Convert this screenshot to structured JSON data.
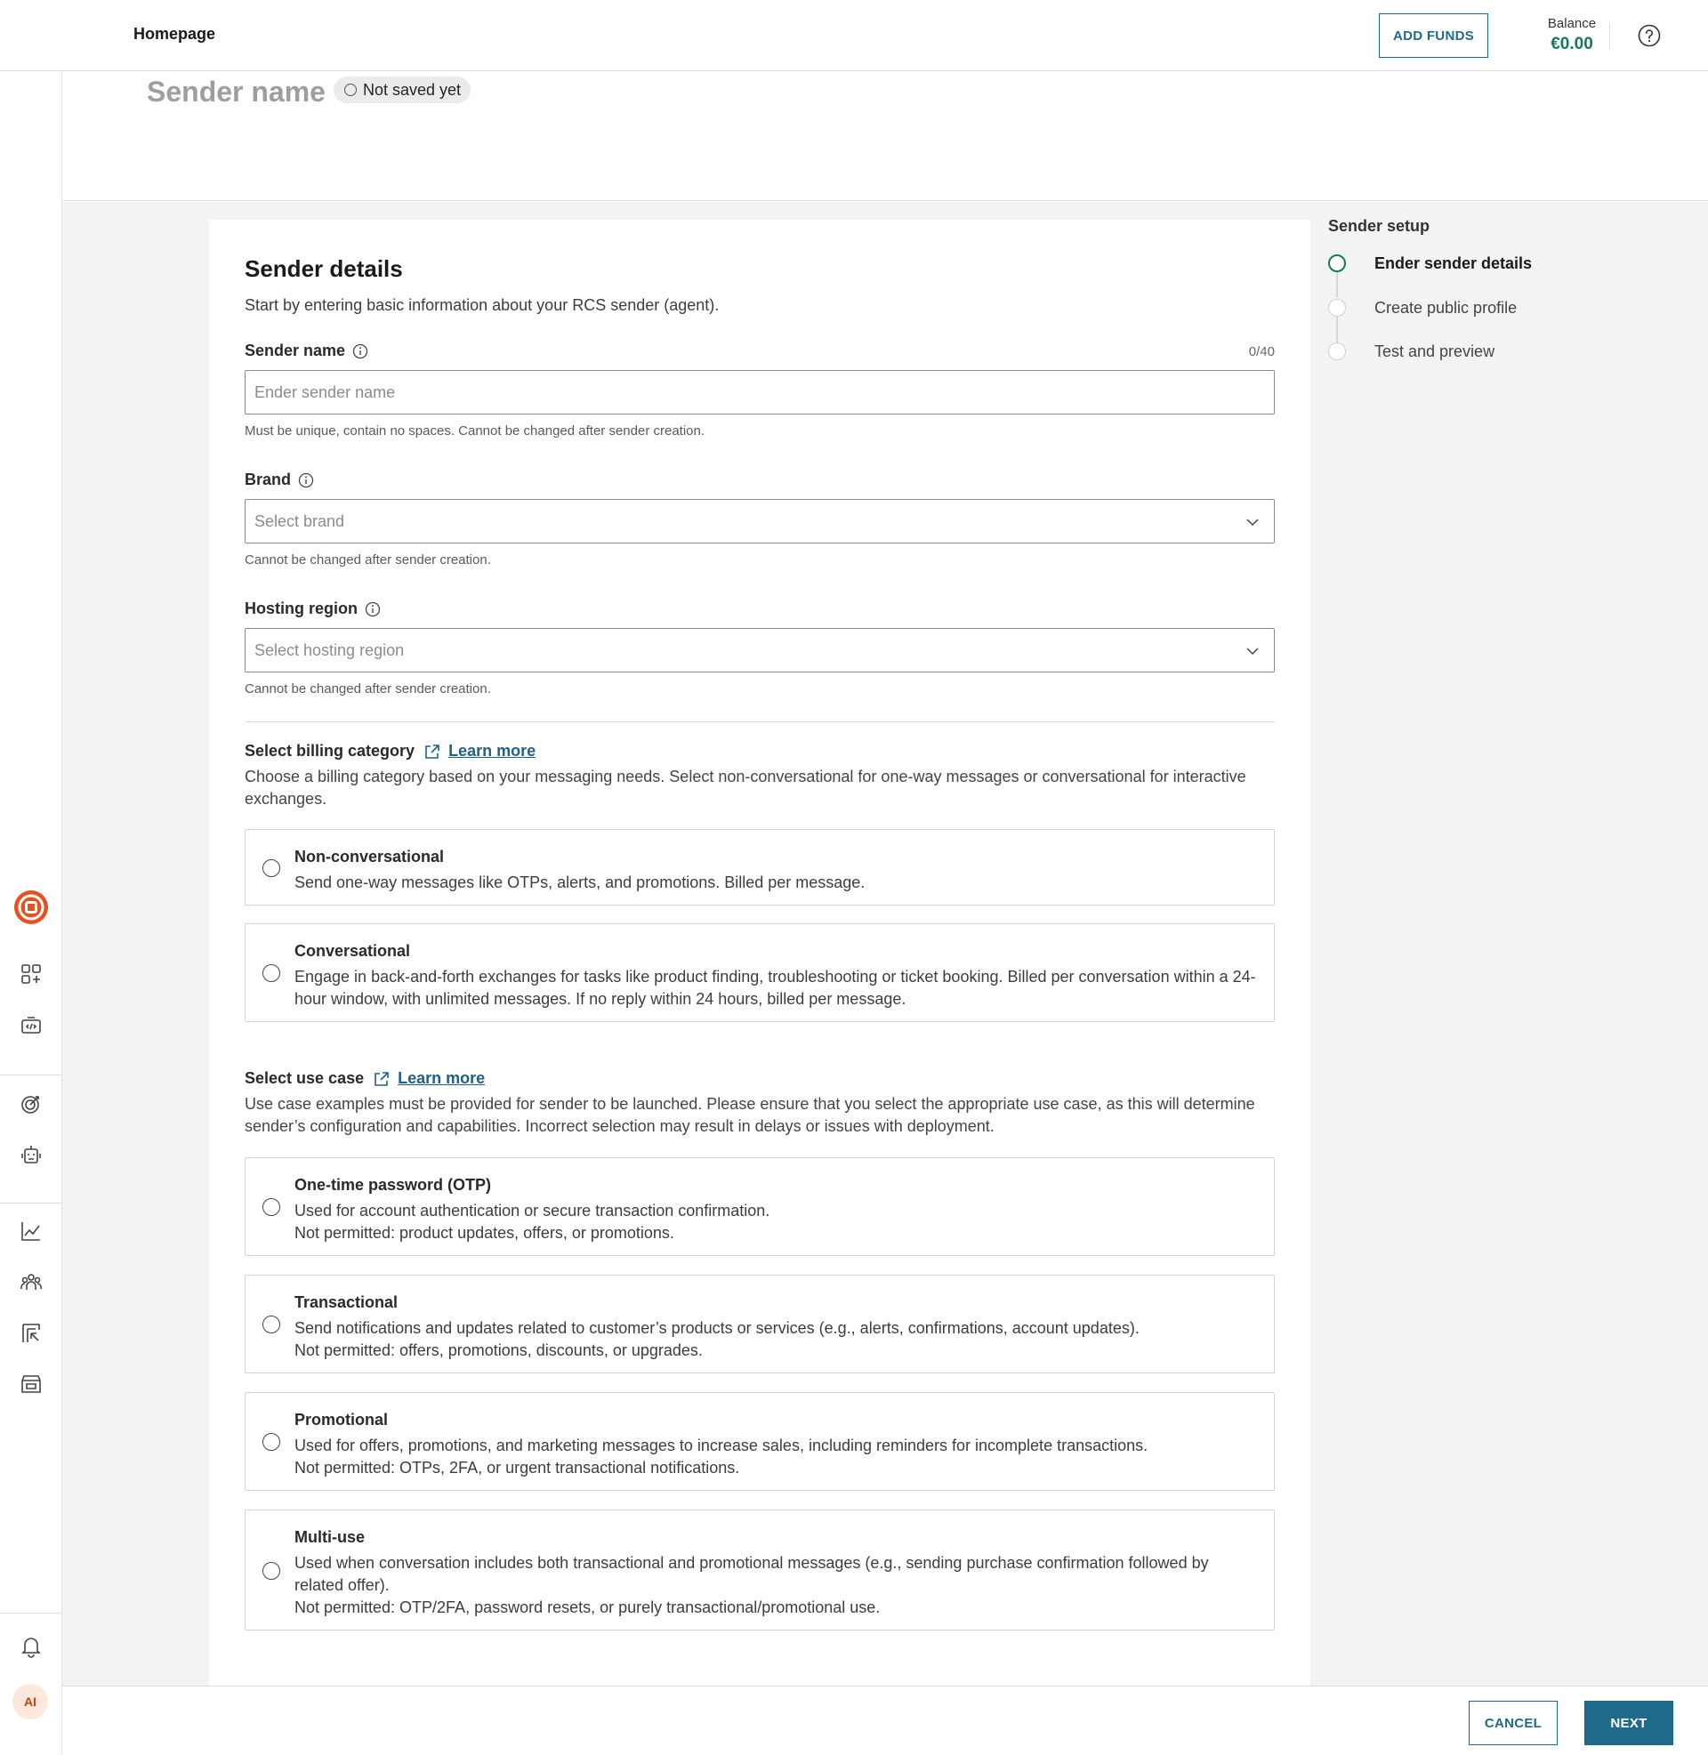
{
  "header": {
    "breadcrumb": "Homepage",
    "add_funds_label": "ADD FUNDS",
    "balance_label": "Balance",
    "balance_value": "€0.00"
  },
  "rail": {
    "avatar_initials": "AI"
  },
  "page": {
    "title": "Sender name",
    "status": "Not saved yet"
  },
  "form": {
    "heading": "Sender details",
    "intro": "Start by entering basic information about your RCS sender (agent).",
    "sender_name": {
      "label": "Sender name",
      "counter": "0/40",
      "placeholder": "Ender sender name",
      "hint": "Must be unique, contain no spaces. Cannot be changed after sender creation."
    },
    "brand": {
      "label": "Brand",
      "placeholder": "Select brand",
      "hint": "Cannot be changed after sender creation."
    },
    "hosting_region": {
      "label": "Hosting region",
      "placeholder": "Select hosting region",
      "hint": "Cannot be changed after sender creation."
    },
    "billing": {
      "title": "Select billing category",
      "learn_more": "Learn more",
      "description": "Choose a billing category based on your messaging needs. Select non-conversational for one-way messages or conversational for interactive exchanges.",
      "options": [
        {
          "title": "Non-conversational",
          "desc": "Send one-way messages like OTPs, alerts, and promotions. Billed per message."
        },
        {
          "title": "Conversational",
          "desc": "Engage in back-and-forth exchanges for tasks like product finding, troubleshooting or ticket booking. Billed per conversation within a 24-hour window, with unlimited messages. If no reply within 24 hours, billed per message."
        }
      ]
    },
    "use_case": {
      "title": "Select use case",
      "learn_more": "Learn more",
      "description": "Use case examples must be provided for sender to be launched. Please ensure that you select the appropriate use case, as this will determine sender’s configuration and capabilities. Incorrect selection may result in delays or issues with deployment.",
      "options": [
        {
          "title": "One-time password (OTP)",
          "desc": "Used for account authentication or secure transaction confirmation.",
          "not_permitted": "Not permitted: product updates, offers, or promotions."
        },
        {
          "title": "Transactional",
          "desc": "Send notifications and updates related to customer’s products or services (e.g., alerts, confirmations, account updates).",
          "not_permitted": "Not permitted: offers, promotions, discounts, or upgrades."
        },
        {
          "title": "Promotional",
          "desc": "Used for offers, promotions, and marketing messages to increase sales, including reminders for incomplete transactions.",
          "not_permitted": "Not permitted: OTPs, 2FA, or urgent transactional notifications."
        },
        {
          "title": "Multi-use",
          "desc": "Used when conversation includes both transactional and promotional messages (e.g., sending purchase confirmation followed by related offer).",
          "not_permitted": "Not permitted: OTP/2FA, password resets, or purely transactional/promotional use."
        }
      ]
    }
  },
  "stepper": {
    "title": "Sender setup",
    "steps": [
      {
        "label": "Ender sender details",
        "state": "active"
      },
      {
        "label": "Create public profile",
        "state": "pending"
      },
      {
        "label": "Test and preview",
        "state": "pending"
      }
    ]
  },
  "footer": {
    "cancel_label": "CANCEL",
    "next_label": "NEXT"
  },
  "colors": {
    "accent": "#1f6a8a",
    "balance_green": "#157b57",
    "brand_orange": "#e8501f",
    "step_active": "#157b57"
  }
}
